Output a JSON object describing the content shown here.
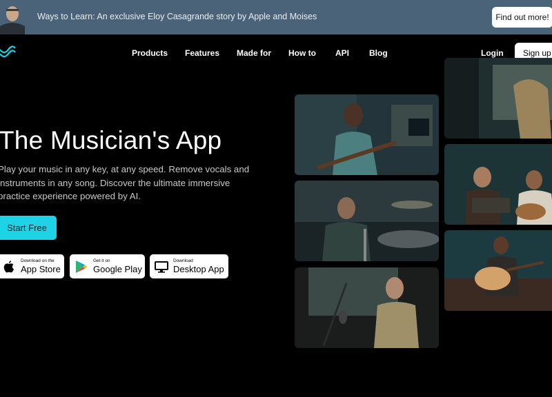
{
  "banner": {
    "text": "Ways to Learn: An exclusive Eloy Casagrande story by Apple and Moises",
    "cta_label": "Find out more!"
  },
  "nav": {
    "links": [
      "Products",
      "Features",
      "Made for",
      "How to",
      "API",
      "Blog"
    ],
    "login_label": "Login",
    "signup_label": "Sign up"
  },
  "hero": {
    "title": "The Musician's App",
    "subtitle_lines": [
      "Play your music in any key, at any speed. Remove vocals and",
      "instruments in any song. Discover the ultimate immersive",
      "practice experience powered by AI."
    ],
    "start_label": "Start Free"
  },
  "stores": {
    "appstore": {
      "small": "Download on the",
      "big": "App Store"
    },
    "googleplay": {
      "small": "Get it on",
      "big": "Google Play"
    },
    "desktop": {
      "small": "Download",
      "big": "Desktop App"
    }
  },
  "colors": {
    "banner_bg": "#4a6378",
    "accent": "#1fd3e6",
    "page_bg": "#000000"
  },
  "icons": [
    "moises-logo-icon",
    "apple-icon",
    "google-play-icon",
    "desktop-monitor-icon"
  ]
}
